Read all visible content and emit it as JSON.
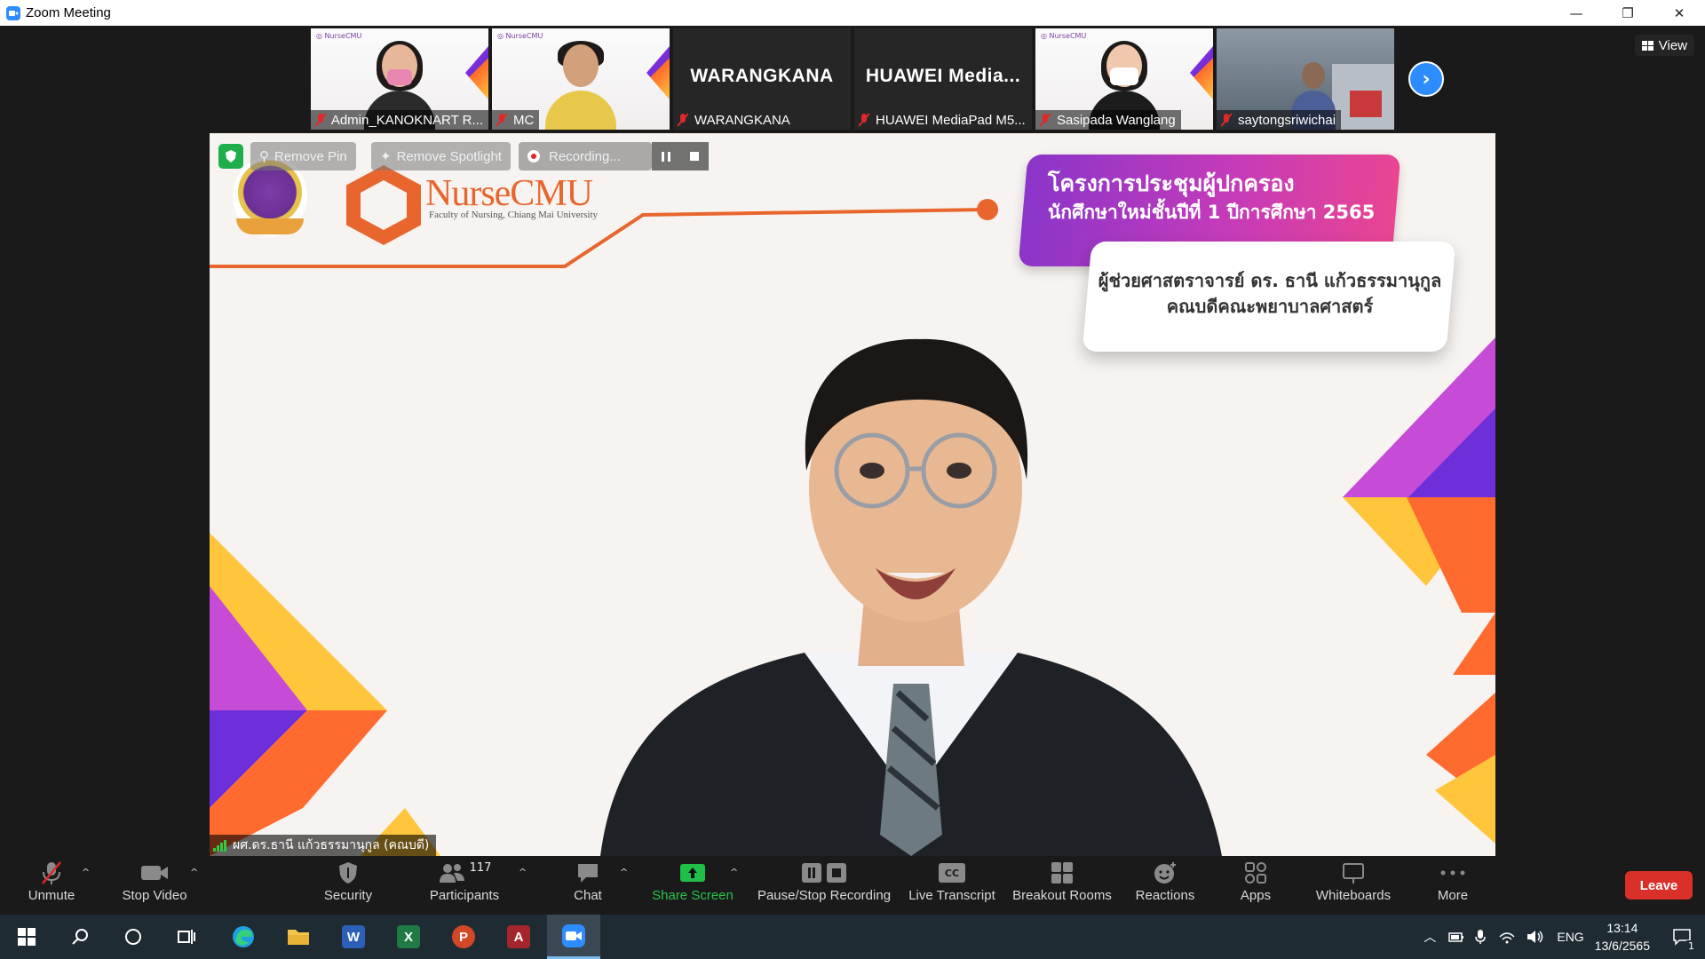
{
  "window": {
    "title": "Zoom Meeting",
    "minimize": "—",
    "restore": "❐",
    "close": "✕"
  },
  "strip": {
    "view_label": "View",
    "participants": [
      {
        "name": "Admin_KANOKNART R...",
        "kind": "video"
      },
      {
        "name": "MC",
        "kind": "video"
      },
      {
        "name": "WARANGKANA",
        "big_name": "WARANGKANA",
        "kind": "name"
      },
      {
        "name": "HUAWEI MediaPad M5...",
        "big_name": "HUAWEI  Media...",
        "kind": "name"
      },
      {
        "name": "Sasipada Wanglang",
        "kind": "video"
      },
      {
        "name": "saytongsriwichai",
        "kind": "video"
      }
    ]
  },
  "main": {
    "remove_pin": "Remove Pin",
    "remove_spotlight": "Remove Spotlight",
    "recording": "Recording...",
    "logo_text": "NurseCMU",
    "logo_sub": "Faculty of Nursing, Chiang Mai University",
    "banner_line1": "โครงการประชุมผู้ปกครอง",
    "banner_line2": "นักศึกษาใหม่ชั้นปีที่ 1 ปีการศึกษา 2565",
    "speaker_line1": "ผู้ช่วยศาสตราจารย์ ดร. ธานี แก้วธรรมานุกูล",
    "speaker_line2": "คณบดีคณะพยาบาลศาสตร์",
    "active_speaker": "ผศ.ดร.ธานี แก้วธรรมานุกูล (คณบดี)"
  },
  "toolbar": {
    "unmute": "Unmute",
    "stop_video": "Stop Video",
    "security": "Security",
    "participants": "Participants",
    "participant_count": "117",
    "chat": "Chat",
    "share_screen": "Share Screen",
    "pause_stop_recording": "Pause/Stop Recording",
    "live_transcript": "Live Transcript",
    "breakout_rooms": "Breakout Rooms",
    "reactions": "Reactions",
    "apps": "Apps",
    "whiteboards": "Whiteboards",
    "more": "More",
    "leave": "Leave",
    "cc": "CC"
  },
  "taskbar": {
    "lang": "ENG",
    "time": "13:14",
    "date": "13/6/2565",
    "notifications": "1",
    "apps": [
      "W",
      "X",
      "P",
      "A"
    ]
  },
  "colors": {
    "accent": "#2d8cff",
    "leave": "#d93029",
    "share": "#27c24c",
    "brand_orange": "#e8662e",
    "banner_purple": "#8a35c9"
  }
}
